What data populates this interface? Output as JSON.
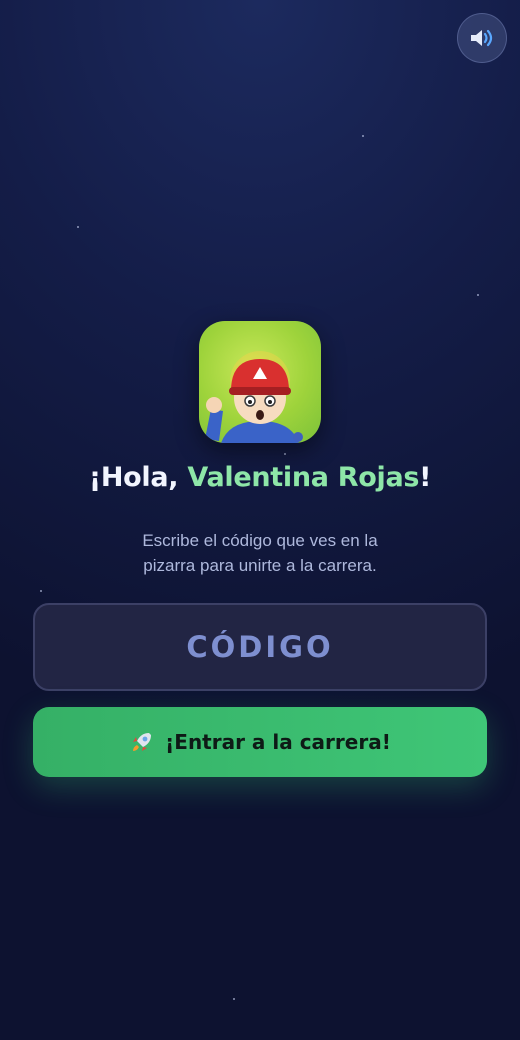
{
  "header": {
    "sound_icon": "speaker-volume-icon"
  },
  "avatar": {
    "icon": "racer-kid-avatar",
    "background": "#9ed33b"
  },
  "greeting": {
    "prefix": "¡Hola, ",
    "name": "Valentina Rojas",
    "suffix": "!"
  },
  "instructions": {
    "line1": "Escribe el código que ves en la",
    "line2": "pizarra para unirte a la carrera."
  },
  "code_field": {
    "placeholder": "CÓDIGO",
    "value": ""
  },
  "enter_button": {
    "icon": "rocket-icon",
    "label": "¡Entrar a la carrera!"
  },
  "colors": {
    "accent_green": "#3fc677",
    "name_green": "#8ee6a8",
    "background": "#141d48"
  }
}
